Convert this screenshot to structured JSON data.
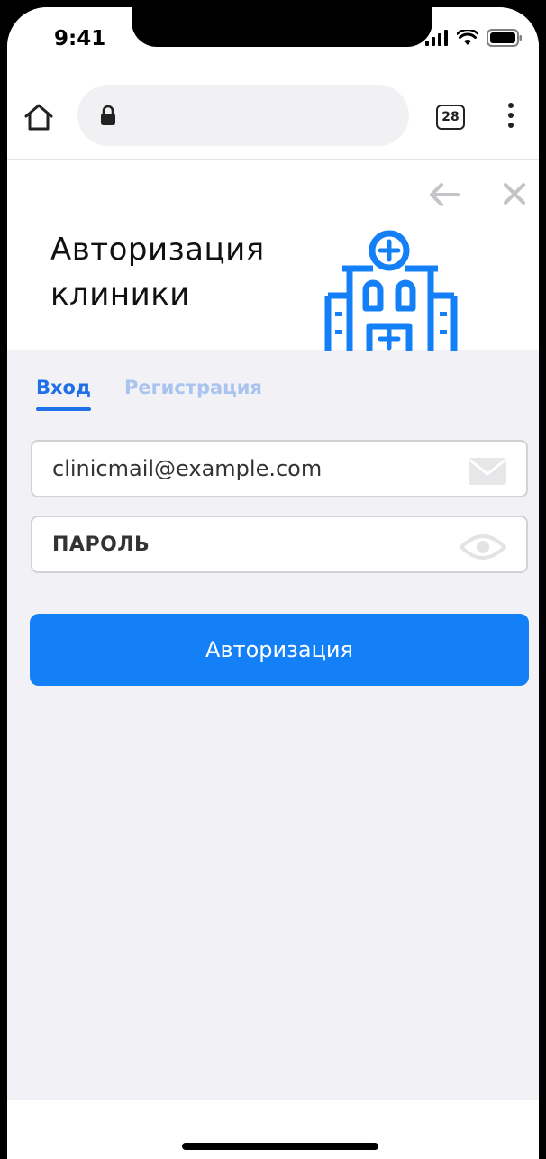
{
  "status_bar": {
    "time": "9:41"
  },
  "browser": {
    "tab_count": "28"
  },
  "header": {
    "title_line1": "Авторизация",
    "title_line2": "клиники"
  },
  "tabs": [
    {
      "label": "Вход",
      "active": true
    },
    {
      "label": "Регистрация",
      "active": false
    }
  ],
  "form": {
    "email_value": "clinicmail@example.com",
    "password_placeholder": "ПАРОЛЬ",
    "submit_label": "Авторизация"
  },
  "colors": {
    "accent": "#1480f8",
    "tab_active": "#1f6fe6",
    "tab_inactive": "#a8c4ef",
    "background": "#f1f1f6"
  },
  "icons": [
    "home-icon",
    "lock-icon",
    "tabs-icon",
    "more-vertical-icon",
    "back-arrow-icon",
    "close-icon",
    "hospital-icon",
    "mail-icon",
    "eye-icon",
    "signal-icon",
    "wifi-icon",
    "battery-icon"
  ]
}
